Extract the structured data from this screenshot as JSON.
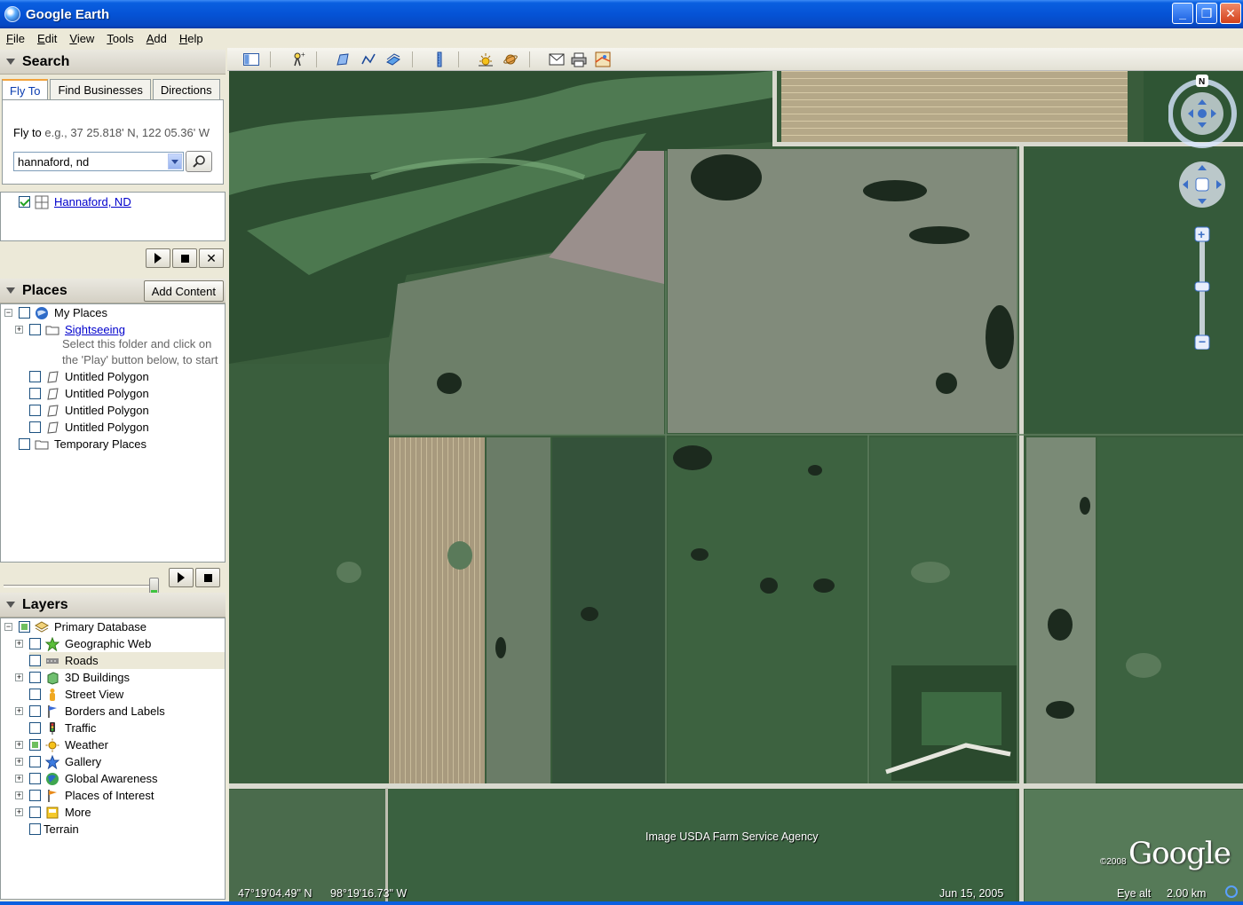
{
  "window": {
    "title": "Google Earth"
  },
  "menu": [
    "File",
    "Edit",
    "View",
    "Tools",
    "Add",
    "Help"
  ],
  "search": {
    "header": "Search",
    "tabs": [
      "Fly To",
      "Find Businesses",
      "Directions"
    ],
    "flyto_label": "Fly to",
    "flyto_hint": "e.g., 37 25.818' N, 122 05.36' W",
    "query": "hannaford, nd",
    "result": "Hannaford, ND"
  },
  "places": {
    "header": "Places",
    "add_content": "Add Content",
    "items": [
      {
        "label": "My Places"
      },
      {
        "label": "Sightseeing"
      },
      {
        "label": "Untitled Polygon"
      },
      {
        "label": "Untitled Polygon"
      },
      {
        "label": "Untitled Polygon"
      },
      {
        "label": "Untitled Polygon"
      },
      {
        "label": "Temporary Places"
      }
    ],
    "sightseeing_note_1": "Select this folder and click on",
    "sightseeing_note_2": "the 'Play' button below, to start"
  },
  "layers": {
    "header": "Layers",
    "items": [
      {
        "label": "Primary Database"
      },
      {
        "label": "Geographic Web"
      },
      {
        "label": "Roads"
      },
      {
        "label": "3D Buildings"
      },
      {
        "label": "Street View"
      },
      {
        "label": "Borders and Labels"
      },
      {
        "label": "Traffic"
      },
      {
        "label": "Weather"
      },
      {
        "label": "Gallery"
      },
      {
        "label": "Global Awareness"
      },
      {
        "label": "Places of Interest"
      },
      {
        "label": "More"
      },
      {
        "label": "Terrain"
      }
    ]
  },
  "toolbar_icons": [
    "sidebar-icon",
    "placemark-icon",
    "polygon-icon",
    "path-icon",
    "image-overlay-icon",
    "ruler-icon",
    "sun-icon",
    "planet-icon",
    "email-icon",
    "print-icon",
    "view-in-maps-icon"
  ],
  "map": {
    "credit": "Image USDA Farm Service Agency",
    "logo": "Google",
    "logo_year": "©2008",
    "north": "N",
    "latitude": "47°19'04.49\" N",
    "longitude": "98°19'16.73\" W",
    "date": "Jun 15, 2005",
    "eye_alt_label": "Eye alt",
    "eye_alt_value": "2.00 km"
  },
  "colors": {
    "titlebar": "#0553d6",
    "field_dark": "#3a5e3a",
    "field_light": "#8e8a7a",
    "road": "#d9d9cf"
  }
}
